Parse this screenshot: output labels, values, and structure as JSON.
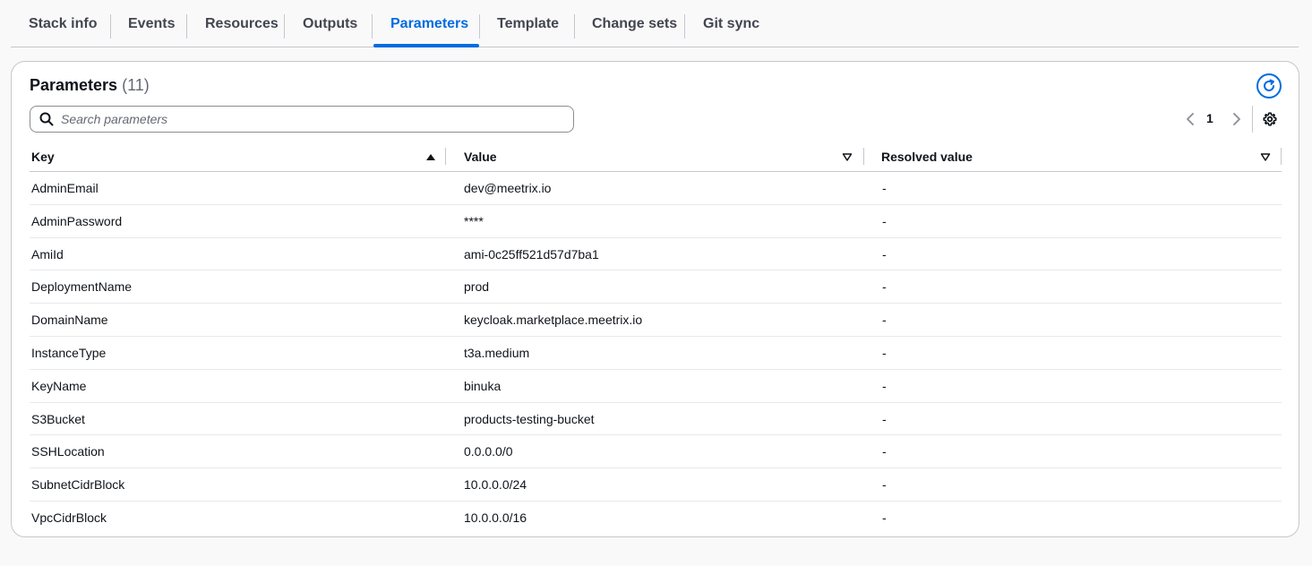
{
  "tabs": [
    {
      "label": "Stack info"
    },
    {
      "label": "Events"
    },
    {
      "label": "Resources"
    },
    {
      "label": "Outputs"
    },
    {
      "label": "Parameters",
      "active": true
    },
    {
      "label": "Template"
    },
    {
      "label": "Change sets"
    },
    {
      "label": "Git sync"
    }
  ],
  "panel": {
    "title": "Parameters",
    "count": "(11)"
  },
  "search": {
    "placeholder": "Search parameters",
    "value": ""
  },
  "pagination": {
    "current_page": "1"
  },
  "table": {
    "columns": [
      {
        "label": "Key",
        "sort": "ascending"
      },
      {
        "label": "Value",
        "sort": "none"
      },
      {
        "label": "Resolved value",
        "sort": "none"
      }
    ],
    "rows": [
      {
        "key": "AdminEmail",
        "value": "dev@meetrix.io",
        "resolved": "-"
      },
      {
        "key": "AdminPassword",
        "value": "****",
        "resolved": "-"
      },
      {
        "key": "AmiId",
        "value": "ami-0c25ff521d57d7ba1",
        "resolved": "-"
      },
      {
        "key": "DeploymentName",
        "value": "prod",
        "resolved": "-"
      },
      {
        "key": "DomainName",
        "value": "keycloak.marketplace.meetrix.io",
        "resolved": "-"
      },
      {
        "key": "InstanceType",
        "value": "t3a.medium",
        "resolved": "-"
      },
      {
        "key": "KeyName",
        "value": "binuka",
        "resolved": "-"
      },
      {
        "key": "S3Bucket",
        "value": "products-testing-bucket",
        "resolved": "-"
      },
      {
        "key": "SSHLocation",
        "value": "0.0.0.0/0",
        "resolved": "-"
      },
      {
        "key": "SubnetCidrBlock",
        "value": "10.0.0.0/24",
        "resolved": "-"
      },
      {
        "key": "VpcCidrBlock",
        "value": "10.0.0.0/16",
        "resolved": "-"
      }
    ]
  },
  "icons": {
    "refresh": "refresh-icon",
    "search": "search-icon",
    "prev": "chevron-left-icon",
    "next": "chevron-right-icon",
    "settings": "gear-icon",
    "sort_asc": "caret-up-filled-icon",
    "sort_none": "caret-down-outline-icon"
  },
  "colors": {
    "accent": "#006ce0",
    "text": "#0f141a",
    "muted": "#656871",
    "border": "#c6c6cd"
  }
}
